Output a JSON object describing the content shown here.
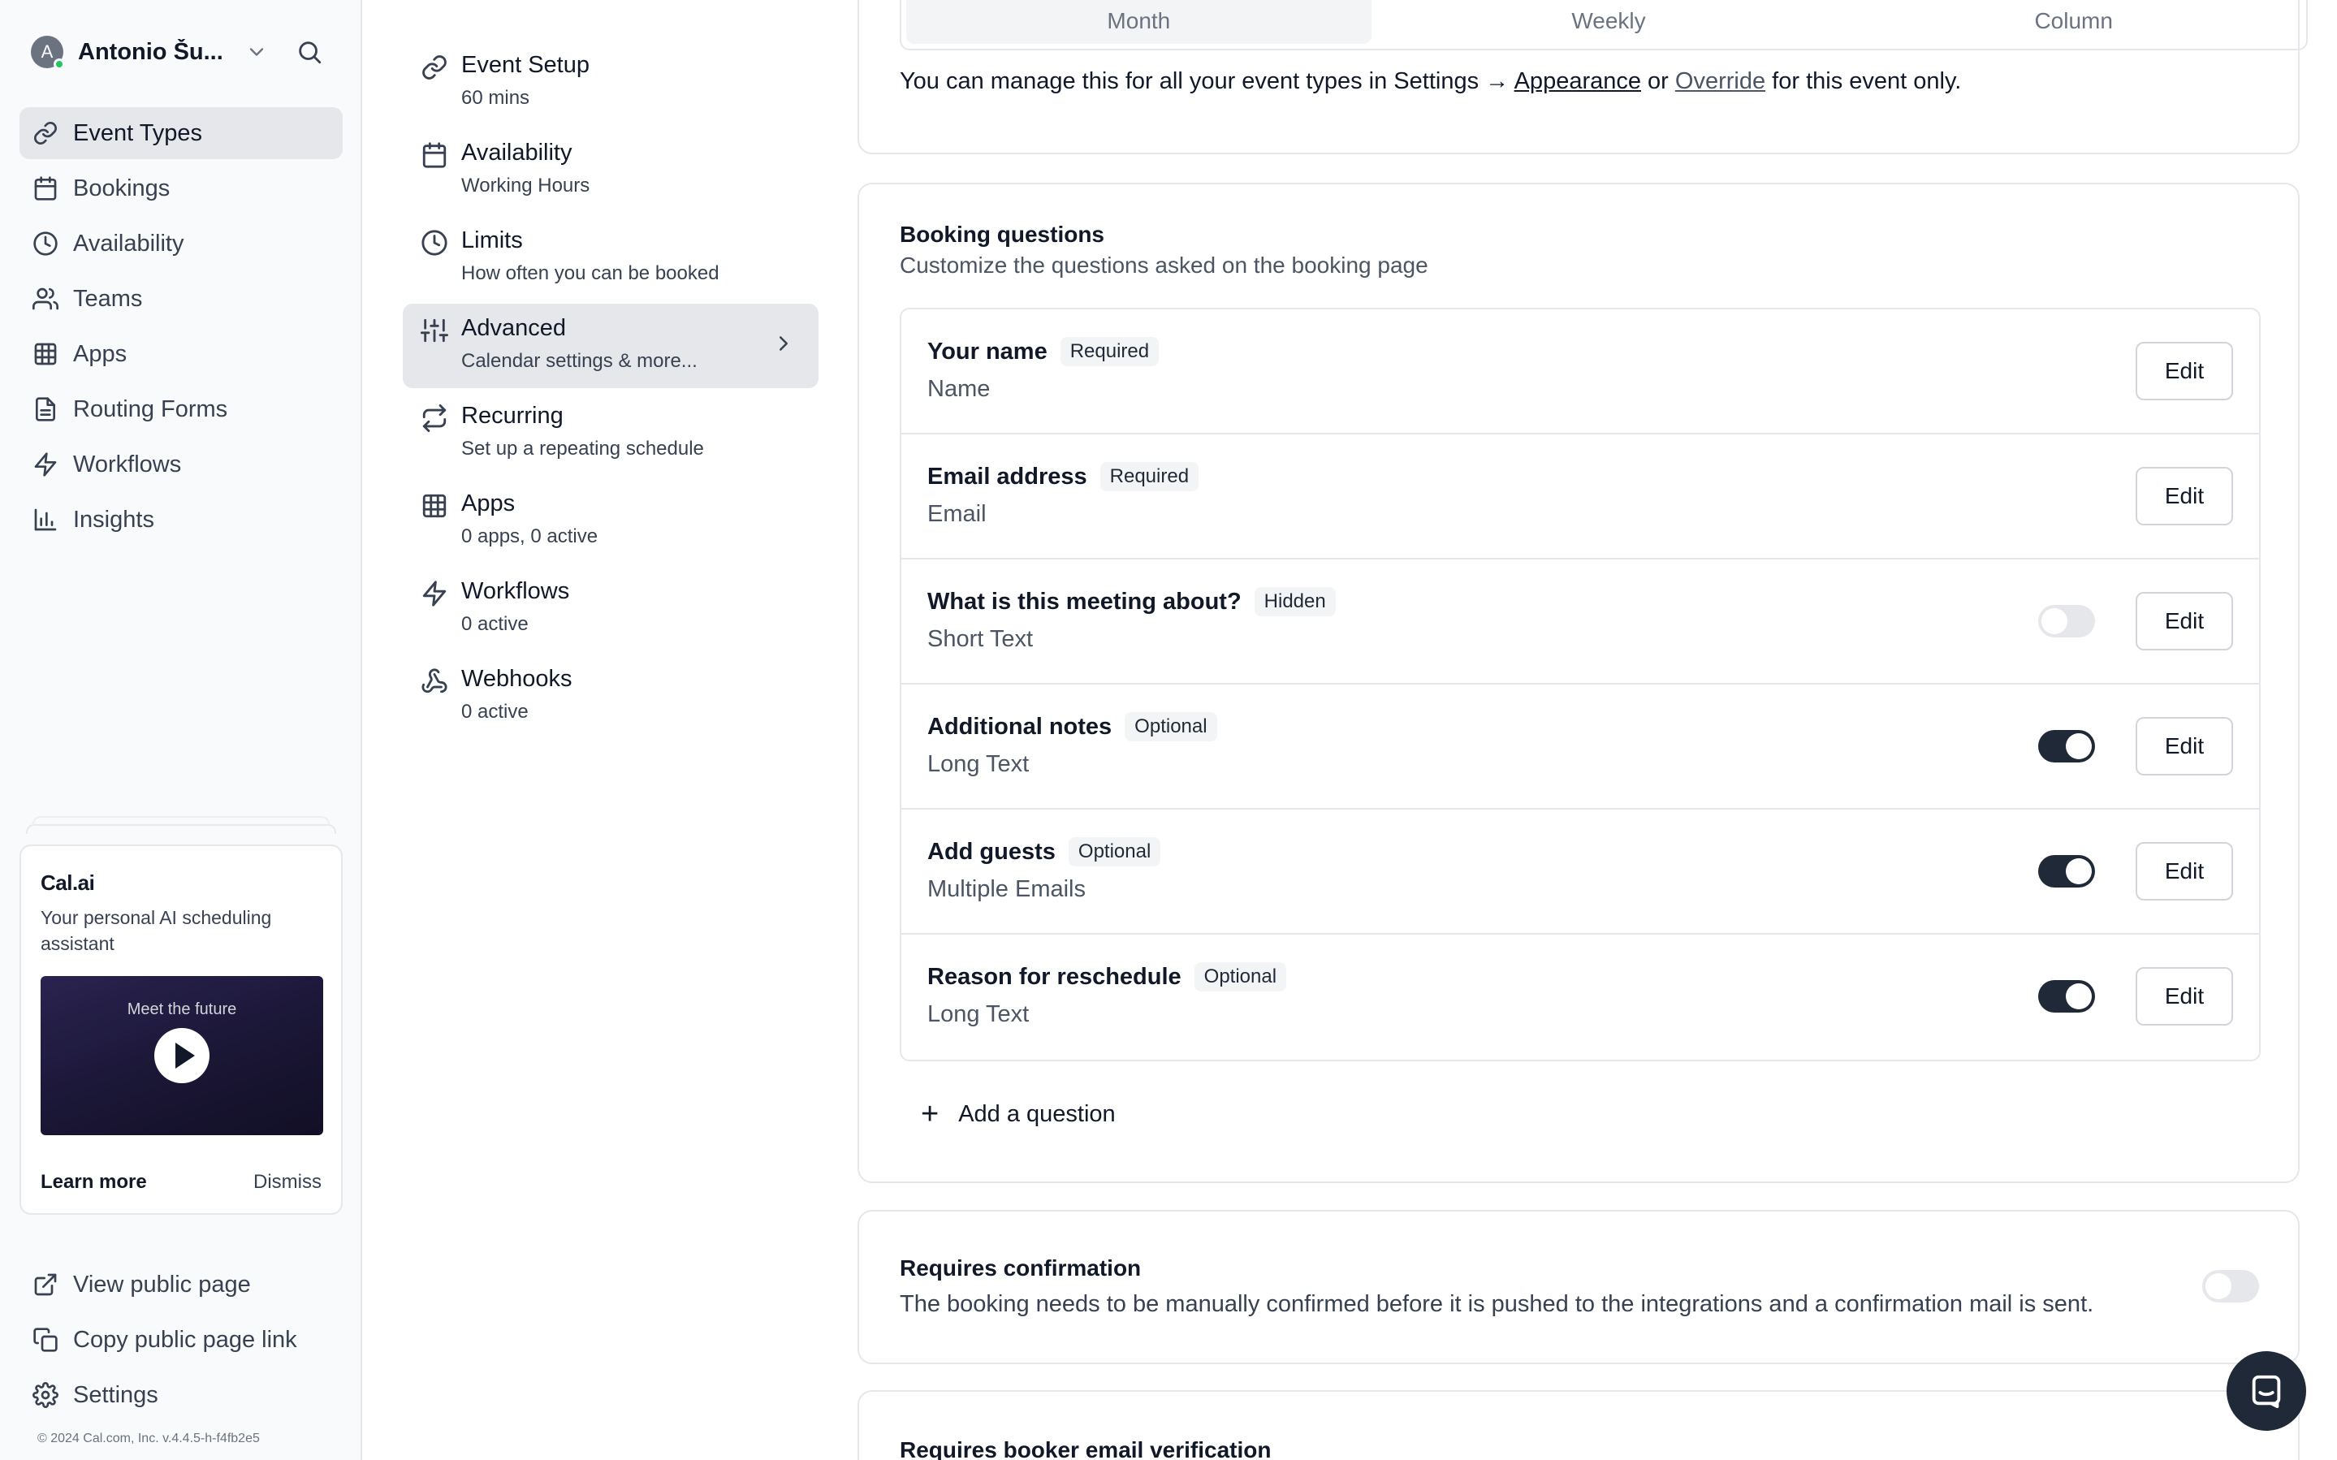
{
  "user": {
    "initial": "A",
    "name": "Antonio Šu..."
  },
  "sidebar": {
    "items": [
      {
        "label": "Event Types",
        "icon": "link-icon",
        "active": true
      },
      {
        "label": "Bookings",
        "icon": "calendar-icon"
      },
      {
        "label": "Availability",
        "icon": "clock-icon"
      },
      {
        "label": "Teams",
        "icon": "users-icon"
      },
      {
        "label": "Apps",
        "icon": "grid-icon"
      },
      {
        "label": "Routing Forms",
        "icon": "file-text-icon"
      },
      {
        "label": "Workflows",
        "icon": "zap-icon"
      },
      {
        "label": "Insights",
        "icon": "bar-chart-icon"
      }
    ],
    "bottom": [
      {
        "label": "View public page",
        "icon": "external-link-icon"
      },
      {
        "label": "Copy public page link",
        "icon": "copy-icon"
      },
      {
        "label": "Settings",
        "icon": "gear-icon"
      }
    ],
    "footer": "© 2024 Cal.com, Inc. v.4.4.5-h-f4fb2e5"
  },
  "promo": {
    "title": "Cal.ai",
    "description": "Your personal AI scheduling assistant",
    "video_caption": "Meet the future",
    "learn_more": "Learn more",
    "dismiss": "Dismiss"
  },
  "subnav": [
    {
      "title": "Event Setup",
      "desc": "60 mins",
      "icon": "link-icon"
    },
    {
      "title": "Availability",
      "desc": "Working Hours",
      "icon": "calendar-icon"
    },
    {
      "title": "Limits",
      "desc": "How often you can be booked",
      "icon": "clock-icon"
    },
    {
      "title": "Advanced",
      "desc": "Calendar settings & more...",
      "icon": "sliders-icon",
      "active": true
    },
    {
      "title": "Recurring",
      "desc": "Set up a repeating schedule",
      "icon": "repeat-icon"
    },
    {
      "title": "Apps",
      "desc": "0 apps, 0 active",
      "icon": "grid-icon"
    },
    {
      "title": "Workflows",
      "desc": "0 active",
      "icon": "zap-icon"
    },
    {
      "title": "Webhooks",
      "desc": "0 active",
      "icon": "webhook-icon"
    }
  ],
  "layout": {
    "options": [
      "Month",
      "Weekly",
      "Column"
    ],
    "selected": "Month",
    "manage_prefix": "You can manage this for all your event types in Settings → ",
    "appearance_link": "Appearance",
    "or": " or ",
    "override_link": "Override",
    "manage_suffix": " for this event only."
  },
  "booking_questions": {
    "title": "Booking questions",
    "description": "Customize the questions asked on the booking page",
    "edit_label": "Edit",
    "items": [
      {
        "label": "Your name",
        "badge": "Required",
        "type": "Name",
        "toggle": null
      },
      {
        "label": "Email address",
        "badge": "Required",
        "type": "Email",
        "toggle": null
      },
      {
        "label": "What is this meeting about?",
        "badge": "Hidden",
        "type": "Short Text",
        "toggle": false
      },
      {
        "label": "Additional notes",
        "badge": "Optional",
        "type": "Long Text",
        "toggle": true
      },
      {
        "label": "Add guests",
        "badge": "Optional",
        "type": "Multiple Emails",
        "toggle": true
      },
      {
        "label": "Reason for reschedule",
        "badge": "Optional",
        "type": "Long Text",
        "toggle": true
      }
    ],
    "add_label": "Add a question"
  },
  "requires_confirmation": {
    "title": "Requires confirmation",
    "description": "The booking needs to be manually confirmed before it is pushed to the integrations and a confirmation mail is sent.",
    "enabled": false
  },
  "requires_verification": {
    "title": "Requires booker email verification"
  }
}
